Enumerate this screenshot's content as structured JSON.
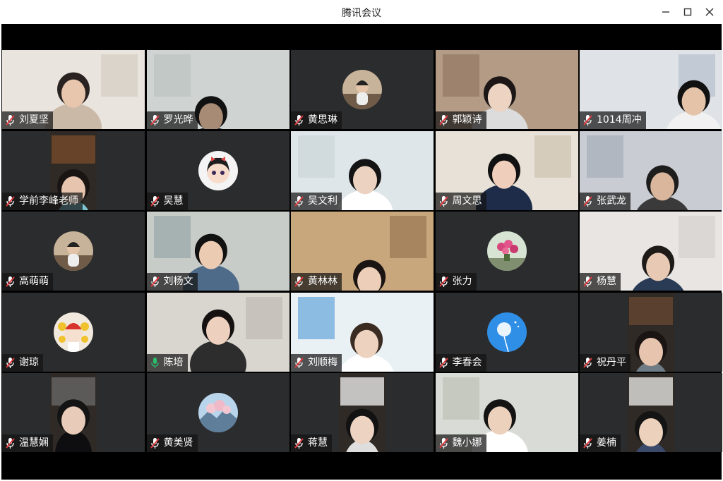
{
  "window": {
    "title": "腾讯会议"
  },
  "participants": [
    {
      "name": "刘夏坚",
      "video": true,
      "mic": "muted"
    },
    {
      "name": "罗光晔",
      "video": true,
      "mic": "muted"
    },
    {
      "name": "黄思琳",
      "video": false,
      "mic": "muted",
      "avatar": "photo-avatar"
    },
    {
      "name": "郭颖诗",
      "video": true,
      "mic": "muted"
    },
    {
      "name": "1014周冲",
      "video": true,
      "mic": "muted"
    },
    {
      "name": "学前李峰老师",
      "video": true,
      "mic": "muted"
    },
    {
      "name": "吴慧",
      "video": false,
      "mic": "muted",
      "avatar": "cartoon-girl-avatar"
    },
    {
      "name": "吴文利",
      "video": true,
      "mic": "muted"
    },
    {
      "name": "周文思",
      "video": true,
      "mic": "muted"
    },
    {
      "name": "张武龙",
      "video": true,
      "mic": "muted"
    },
    {
      "name": "高萌萌",
      "video": false,
      "mic": "muted",
      "avatar": "photo-avatar"
    },
    {
      "name": "刘杨文",
      "video": true,
      "mic": "muted"
    },
    {
      "name": "黄林林",
      "video": true,
      "mic": "muted"
    },
    {
      "name": "张力",
      "video": false,
      "mic": "muted",
      "avatar": "flowers-avatar"
    },
    {
      "name": "杨慧",
      "video": true,
      "mic": "muted"
    },
    {
      "name": "谢琼",
      "video": false,
      "mic": "muted",
      "avatar": "cartoon-avatar"
    },
    {
      "name": "陈培",
      "video": true,
      "mic": "speaking"
    },
    {
      "name": "刘顺梅",
      "video": true,
      "mic": "muted"
    },
    {
      "name": "李春会",
      "video": false,
      "mic": "muted",
      "avatar": "dandelion-avatar"
    },
    {
      "name": "祝丹平",
      "video": true,
      "mic": "muted"
    },
    {
      "name": "温慧娴",
      "video": true,
      "mic": "muted"
    },
    {
      "name": "黄美贤",
      "video": false,
      "mic": "muted",
      "avatar": "landscape-avatar"
    },
    {
      "name": "蒋慧",
      "video": true,
      "mic": "muted"
    },
    {
      "name": "魏小娜",
      "video": true,
      "mic": "muted"
    },
    {
      "name": "姜楠",
      "video": true,
      "mic": "muted"
    }
  ]
}
